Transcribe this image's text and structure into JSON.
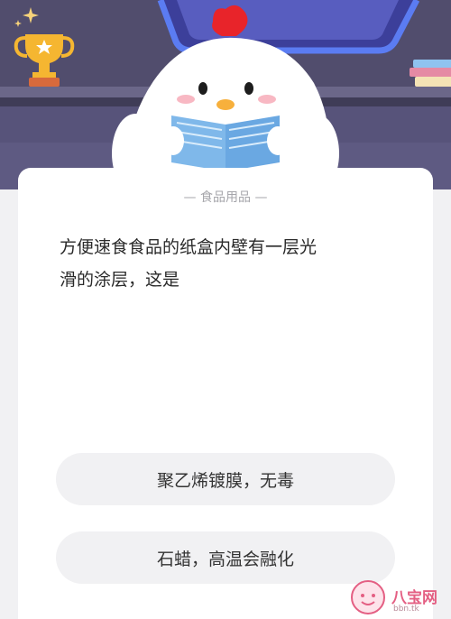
{
  "category": {
    "label": "食品用品"
  },
  "question": {
    "line1": "方便速食食品的纸盒内壁有一层光",
    "line2": "滑的涂层，这是"
  },
  "options": [
    {
      "label": "聚乙烯镀膜，无毒"
    },
    {
      "label": "石蜡，高温会融化"
    }
  ],
  "watermark": {
    "text": "八宝网",
    "url": "bbn.tk"
  },
  "icons": {
    "trophy": "trophy-icon",
    "sparkle": "sparkle-icon",
    "mascot": "chick-mascot-icon",
    "books": "book-stack-icon",
    "watermark_logo": "watermark-face-icon"
  },
  "colors": {
    "header_bg": "#4c4968",
    "card_bg": "#ffffff",
    "option_bg": "#f1f1f3",
    "screen_border": "#5b7cf2",
    "accent_red": "#e8242a"
  }
}
